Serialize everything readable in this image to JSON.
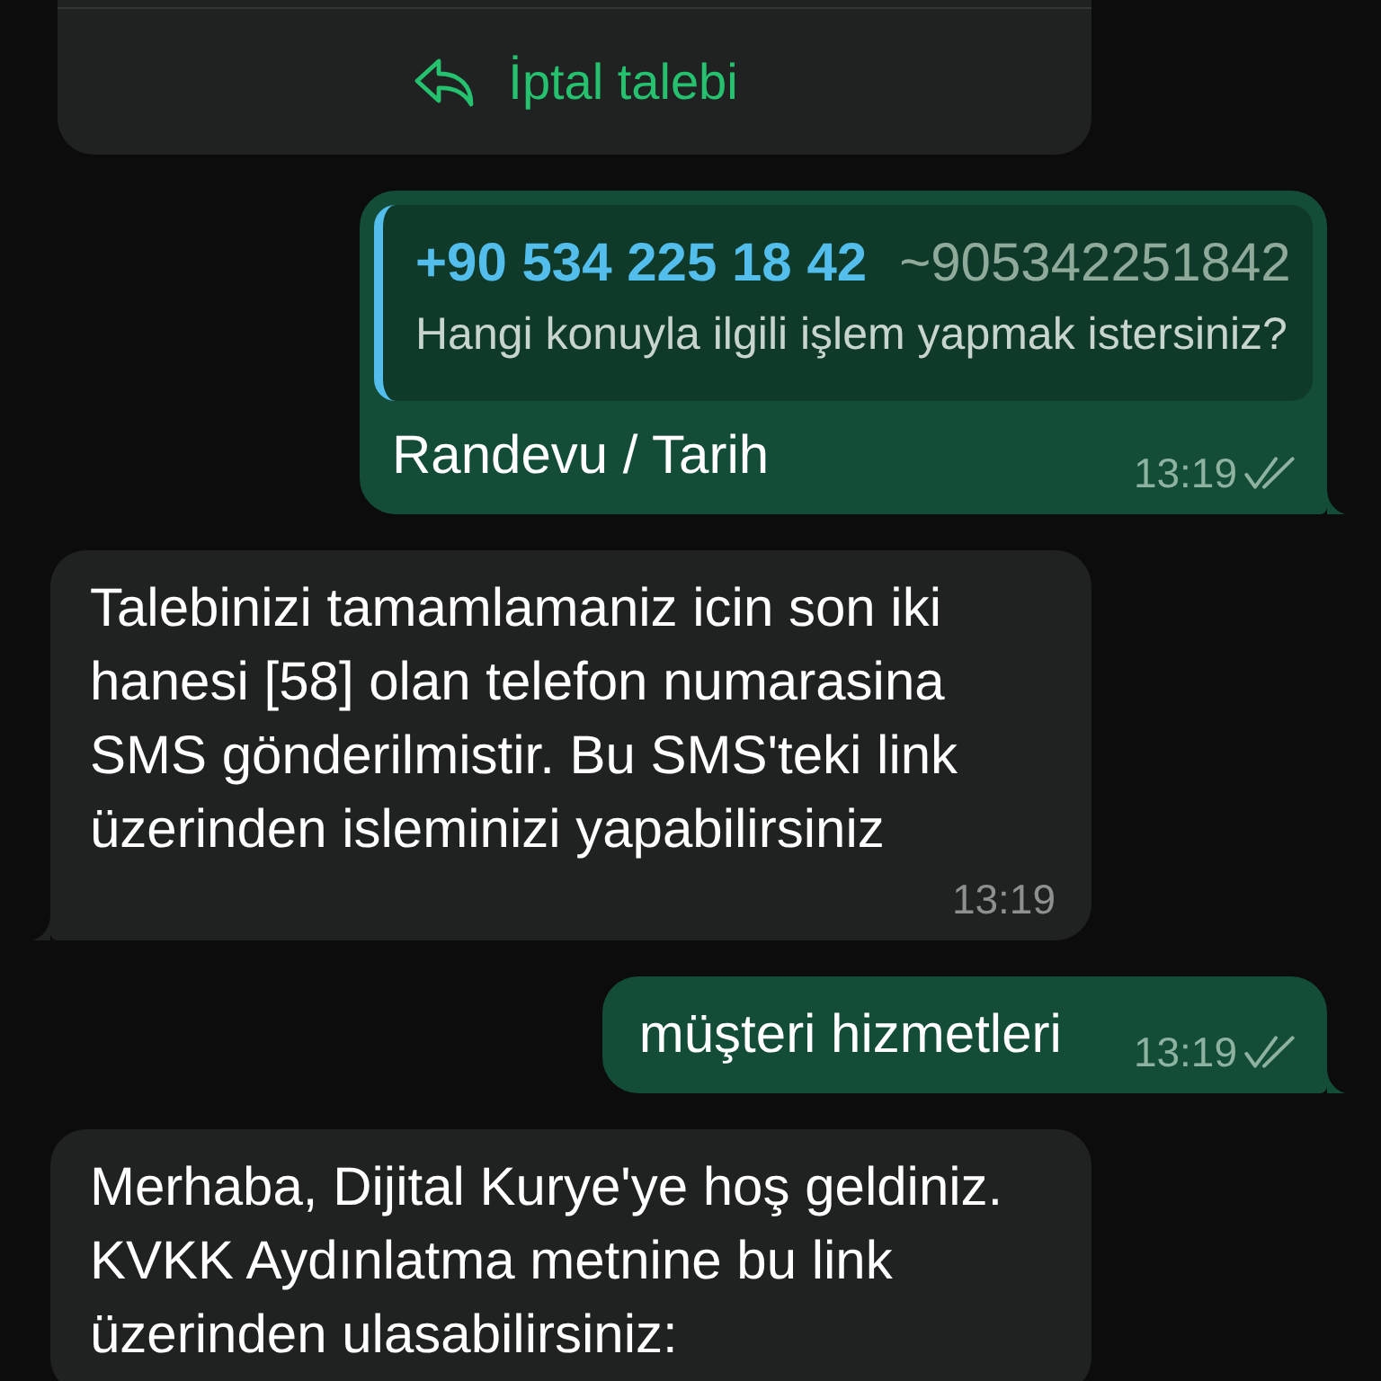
{
  "messages": [
    {
      "kind": "buttons",
      "outgoing": false,
      "tail": false,
      "buttons": [
        {
          "label": "İptal talebi"
        }
      ]
    },
    {
      "kind": "reply",
      "outgoing": true,
      "tail": true,
      "quote": {
        "sender_number": "+90 534 225 18 42",
        "sender_name": "~905342251842",
        "text": "Hangi konuyla ilgili işlem yapmak istersiniz?"
      },
      "text": "Randevu / Tarih",
      "time": "13:19",
      "read": false
    },
    {
      "kind": "text",
      "outgoing": false,
      "tail": true,
      "text": "Talebinizi tamamlamaniz icin son iki hanesi [58] olan telefon numarasina SMS gönderilmistir. Bu SMS'teki link üzerinden isleminizi yapabilirsiniz",
      "time": "13:19"
    },
    {
      "kind": "text",
      "outgoing": true,
      "tail": true,
      "text": "müşteri hizmetleri",
      "time": "13:19",
      "read": false
    },
    {
      "kind": "text",
      "outgoing": false,
      "tail": false,
      "text": "Merhaba, Dijital Kurye'ye hoş geldiniz. KVKK Aydınlatma metnine bu link üzerinden ulasabilirsiniz:"
    }
  ]
}
